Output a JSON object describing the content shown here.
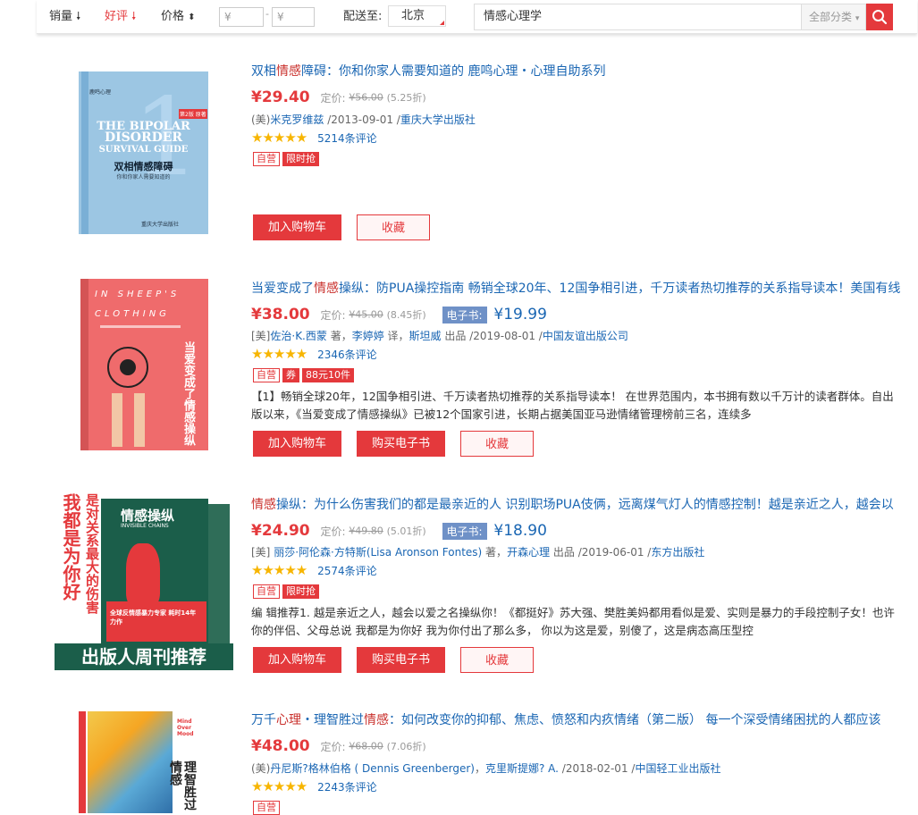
{
  "toolbar": {
    "sort_sales": "销量",
    "sort_rating": "好评",
    "sort_price": "价格",
    "price_min_placeholder": "¥",
    "price_max_placeholder": "¥",
    "price_dash": "-",
    "ship_to_label": "配送至:",
    "ship_to_value": "北京",
    "search_value": "情感心理学",
    "category_value": "全部分类",
    "accent_color": "#e4393c"
  },
  "products": [
    {
      "title_pre": "双相",
      "title_hl": "情感",
      "title_post": "障碍：你和你家人需要知道的 鹿鸣心理・心理自助系列",
      "price": "¥29.40",
      "list_label": "定价:",
      "list_price": "¥56.00",
      "discount": "(5.25折)",
      "meta": {
        "prefix": "(美)",
        "author": "米克罗维兹",
        "date": " /2013-09-01 /",
        "publisher": "重庆大学出版社"
      },
      "reviews": "5214条评论",
      "tags": [
        "自营",
        "限时抢"
      ],
      "buttons": [
        "加入购物车",
        "收藏"
      ]
    },
    {
      "title_pre": "当爱变成了",
      "title_hl": "情感",
      "title_post": "操纵：防PUA操控指南 畅销全球20年、12国争相引进，千万读者热切推荐的关系指导读本！美国有线",
      "price": "¥38.00",
      "list_label": "定价:",
      "list_price": "¥45.00",
      "discount": "(8.45折)",
      "ebook_label": "电子书:",
      "ebook_price": "¥19.99",
      "meta": {
        "prefix": "[美]",
        "author": "佐治·K.西蒙",
        "mid1": " 著，",
        "translator": "李婷婷",
        "mid2": " 译，",
        "producer": "斯坦威",
        "mid3": " 出品 /2019-08-01 /",
        "publisher": "中国友谊出版公司"
      },
      "reviews": "2346条评论",
      "tags": [
        "自营",
        "券",
        "88元10件"
      ],
      "description": "【1】畅销全球20年，12国争相引进、千万读者热切推荐的关系指导读本！ 在世界范围内，本书拥有数以千万计的读者群体。自出版以来，《当爱变成了情感操纵》已被12个国家引进，长期占据美国亚马逊情绪管理榜前三名，连续多",
      "buttons": [
        "加入购物车",
        "购买电子书",
        "收藏"
      ]
    },
    {
      "title_pre": "",
      "title_hl": "情感",
      "title_post": "操纵：为什么伤害我们的都是最亲近的人 识别职场PUA伎俩，远离煤气灯人的情感控制！越是亲近之人，越会以",
      "price": "¥24.90",
      "list_label": "定价:",
      "list_price": "¥49.80",
      "discount": "(5.01折)",
      "ebook_label": "电子书:",
      "ebook_price": "¥18.90",
      "meta": {
        "prefix": "[美] ",
        "author": "丽莎·阿伦森·方特斯(Lisa Aronson Fontes)",
        "mid1": " 著，",
        "producer": "开森心理",
        "mid3": " 出品 /2019-06-01 /",
        "publisher": "东方出版社"
      },
      "reviews": "2574条评论",
      "tags": [
        "自营",
        "限时抢"
      ],
      "description": "编 辑推荐1. 越是亲近之人，越会以爱之名操纵你！《都挺好》苏大强、樊胜美妈都用看似是爱、实则是暴力的手段控制子女！也许你的伴侣、父母总说 我都是为你好 我为你付出了那么多， 你以为这是爱，别傻了，这是病态高压型控",
      "buttons": [
        "加入购物车",
        "购买电子书",
        "收藏"
      ]
    },
    {
      "title_pre": "万千",
      "title_hl": "心理",
      "title_mid": "・理智胜过",
      "title_hl2": "情感",
      "title_post": "：如何改变你的抑郁、焦虑、愤怒和内疚情绪（第二版） 每一个深受情绪困扰的人都应该",
      "price": "¥48.00",
      "list_label": "定价:",
      "list_price": "¥68.00",
      "discount": "(7.06折)",
      "meta": {
        "prefix": "(美)",
        "author": "丹尼斯?格林伯格 ( Dennis Greenberger)",
        "mid1": "，",
        "translator": "克里斯提娜? A.",
        "mid3": " /2018-02-01 /",
        "publisher": "中国轻工业出版社"
      },
      "reviews": "2243条评论",
      "tags": [
        "自营"
      ]
    }
  ],
  "covers": {
    "c1": {
      "brand": "鹿鸣心理",
      "en1": "THE BIPOLAR",
      "en2": "DISORDER",
      "en3": "SURVIVAL GUIDE",
      "zh": "双相情感障碍",
      "sub": "你和你家人需要知道的",
      "badge": "第2版 原著",
      "publisher": "重庆大学出版社"
    },
    "c2": {
      "en1": "IN SHEEP'S",
      "en2": "CLOTHING",
      "zh": "当爱变成了情感操纵"
    },
    "c3": {
      "side": "我都是为你好",
      "side2": "是对关系最大的伤害",
      "zh": "情感操纵",
      "en": "INVISIBLE CHAINS",
      "promo": "全球反情感暴力专家 耗时14年 力作",
      "banner": "出版人周刊推荐"
    },
    "c4": {
      "zh": "理智胜过情感",
      "en": "Mind Over Mood"
    }
  }
}
